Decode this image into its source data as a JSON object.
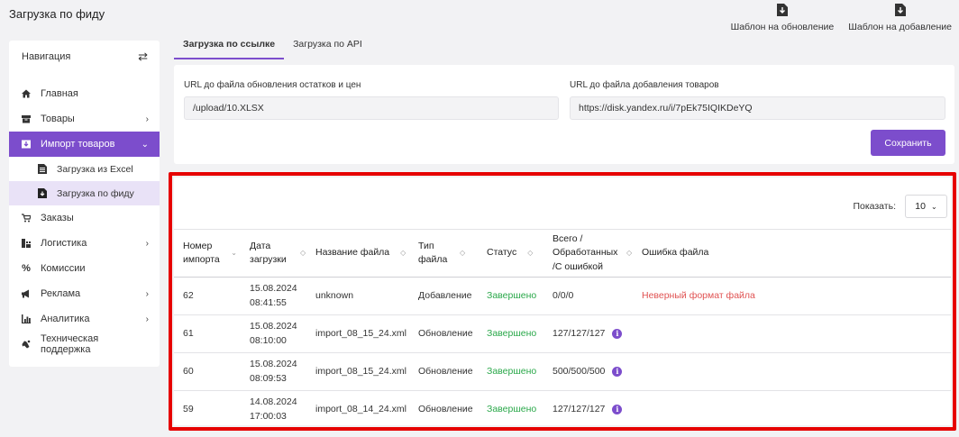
{
  "page": {
    "title": "Загрузка по фиду"
  },
  "top_actions": [
    {
      "label": "Шаблон на обновление",
      "icon": "download-file-icon"
    },
    {
      "label": "Шаблон на добавление",
      "icon": "download-file-icon"
    }
  ],
  "sidebar": {
    "header": "Навигация",
    "items": [
      {
        "label": "Главная",
        "icon": "home-icon"
      },
      {
        "label": "Товары",
        "icon": "box-icon",
        "chevron": "›"
      },
      {
        "label": "Импорт товаров",
        "icon": "import-icon",
        "chevron": "⌄"
      },
      {
        "label": "Загрузка из Excel",
        "icon": "excel-file-icon"
      },
      {
        "label": "Загрузка по фиду",
        "icon": "feed-file-icon"
      },
      {
        "label": "Заказы",
        "icon": "cart-icon"
      },
      {
        "label": "Логистика",
        "icon": "logistics-icon",
        "chevron": "›"
      },
      {
        "label": "Комиссии",
        "icon": "percent-icon"
      },
      {
        "label": "Реклама",
        "icon": "megaphone-icon",
        "chevron": "›"
      },
      {
        "label": "Аналитика",
        "icon": "bar-chart-icon",
        "chevron": "›"
      },
      {
        "label": "Техническая поддержка",
        "icon": "support-icon"
      }
    ]
  },
  "tabs": [
    {
      "label": "Загрузка по ссылке",
      "active": true
    },
    {
      "label": "Загрузка по API",
      "active": false
    }
  ],
  "form": {
    "update_label": "URL до файла обновления остатков и цен",
    "update_value": "/upload/10.XLSX",
    "add_label": "URL до файла добавления товаров",
    "add_value": "https://disk.yandex.ru/i/7pEk75IQIKDeYQ",
    "save_label": "Сохранить"
  },
  "table": {
    "show_label": "Показать:",
    "page_size": "10",
    "columns": [
      "Номер импорта",
      "Дата загрузки",
      "Название файла",
      "Тип файла",
      "Статус",
      "Всего / Обработанных /С ошибкой",
      "Ошибка файла"
    ],
    "rows": [
      {
        "id": "62",
        "date": "15.08.2024",
        "time": "08:41:55",
        "file": "unknown",
        "type": "Добавление",
        "status": "Завершено",
        "counts": "0/0/0",
        "error": "Неверный формат файла"
      },
      {
        "id": "61",
        "date": "15.08.2024",
        "time": "08:10:00",
        "file": "import_08_15_24.xml",
        "type": "Обновление",
        "status": "Завершено",
        "counts": "127/127/127",
        "error": ""
      },
      {
        "id": "60",
        "date": "15.08.2024",
        "time": "08:09:53",
        "file": "import_08_15_24.xml",
        "type": "Обновление",
        "status": "Завершено",
        "counts": "500/500/500",
        "error": ""
      },
      {
        "id": "59",
        "date": "14.08.2024",
        "time": "17:00:03",
        "file": "import_08_14_24.xml",
        "type": "Обновление",
        "status": "Завершено",
        "counts": "127/127/127",
        "error": ""
      }
    ]
  },
  "colors": {
    "accent": "#7c4dcc",
    "success": "#2aa84a",
    "error": "#e05252",
    "highlight_frame": "#e60000"
  }
}
